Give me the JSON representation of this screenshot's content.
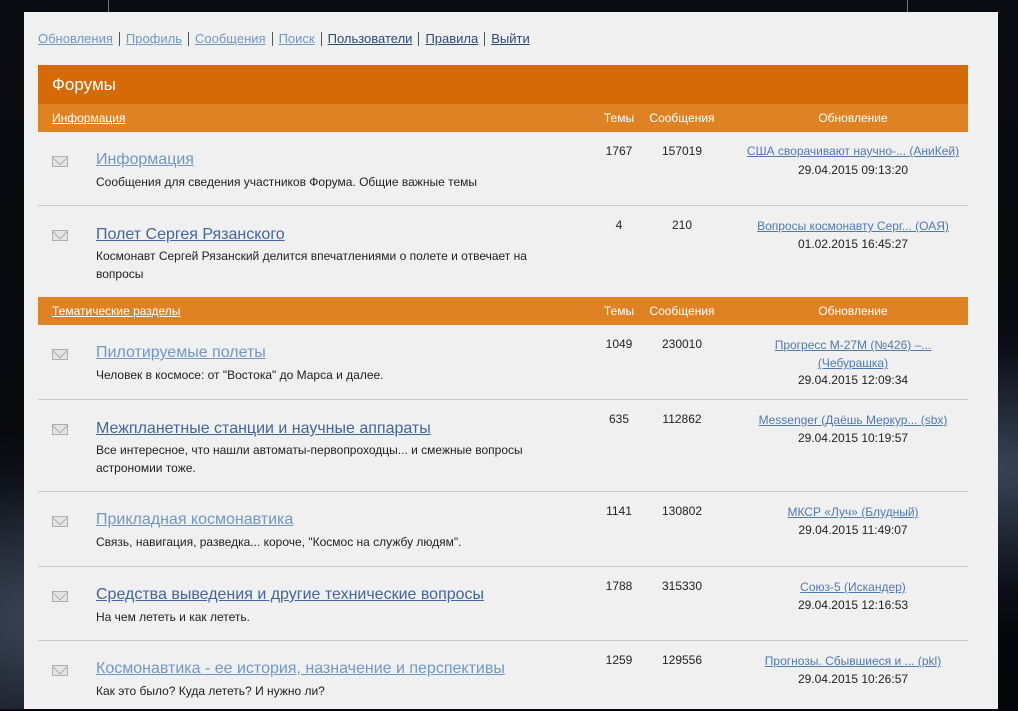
{
  "nav": {
    "items": [
      {
        "label": "Обновления"
      },
      {
        "label": "Профиль"
      },
      {
        "label": "Сообщения"
      },
      {
        "label": "Поиск"
      },
      {
        "label": "Пользователи"
      },
      {
        "label": "Правила"
      },
      {
        "label": "Выйти"
      }
    ]
  },
  "forums": {
    "title": "Форумы",
    "categories": [
      {
        "name": "Информация",
        "col_topics": "Темы",
        "col_posts": "Сообщения",
        "col_last": "Обновление",
        "rows": [
          {
            "title": "Информация",
            "desc": "Сообщения для сведения участников Форума. Общие важные темы",
            "topics": "1767",
            "posts": "157019",
            "last_topic": "США сворачивают научно-... (АниКей)",
            "last_date": "29.04.2015 09:13:20"
          },
          {
            "title": "Полет Сергея Рязанского",
            "desc": "Космонавт Сергей Рязанский делится впечатлениями о полете и отвечает на вопросы",
            "topics": "4",
            "posts": "210",
            "last_topic": "Вопросы космонавту Серг... (ОАЯ)",
            "last_date": "01.02.2015 16:45:27"
          }
        ]
      },
      {
        "name": "Тематические разделы",
        "col_topics": "Темы",
        "col_posts": "Сообщения",
        "col_last": "Обновление",
        "rows": [
          {
            "title": "Пилотируемые полеты",
            "desc": "Человек в космосе: от \"Востока\" до Марса и далее.",
            "topics": "1049",
            "posts": "230010",
            "last_topic": "Прогресс М-27М (№426) –... (Чебурашка)",
            "last_date": "29.04.2015 12:09:34"
          },
          {
            "title": "Межпланетные станции и научные аппараты",
            "desc": "Все интересное, что нашли автоматы-первопроходцы... и смежные вопросы астрономии тоже.",
            "topics": "635",
            "posts": "112862",
            "last_topic": "Messenger (Даёшь Меркур... (sbx)",
            "last_date": "29.04.2015 10:19:57"
          },
          {
            "title": "Прикладная космонавтика",
            "desc": "Связь, навигация, разведка... короче, \"Космос на службу людям\".",
            "topics": "1141",
            "posts": "130802",
            "last_topic": "МКСР «Луч» (Блудный)",
            "last_date": "29.04.2015 11:49:07"
          },
          {
            "title": "Средства выведения и другие технические вопросы",
            "desc": "На чем лететь и как лететь.",
            "topics": "1788",
            "posts": "315330",
            "last_topic": "Союз-5 (Искандер)",
            "last_date": "29.04.2015 12:16:53"
          },
          {
            "title": "Космонавтика - ее история, назначение и перспективы",
            "desc": "Как это было? Куда лететь? И нужно ли?",
            "topics": "1259",
            "posts": "129556",
            "last_topic": "Прогнозы. Сбывшиеся и ... (pkl)",
            "last_date": "29.04.2015 10:26:57"
          }
        ]
      }
    ]
  }
}
